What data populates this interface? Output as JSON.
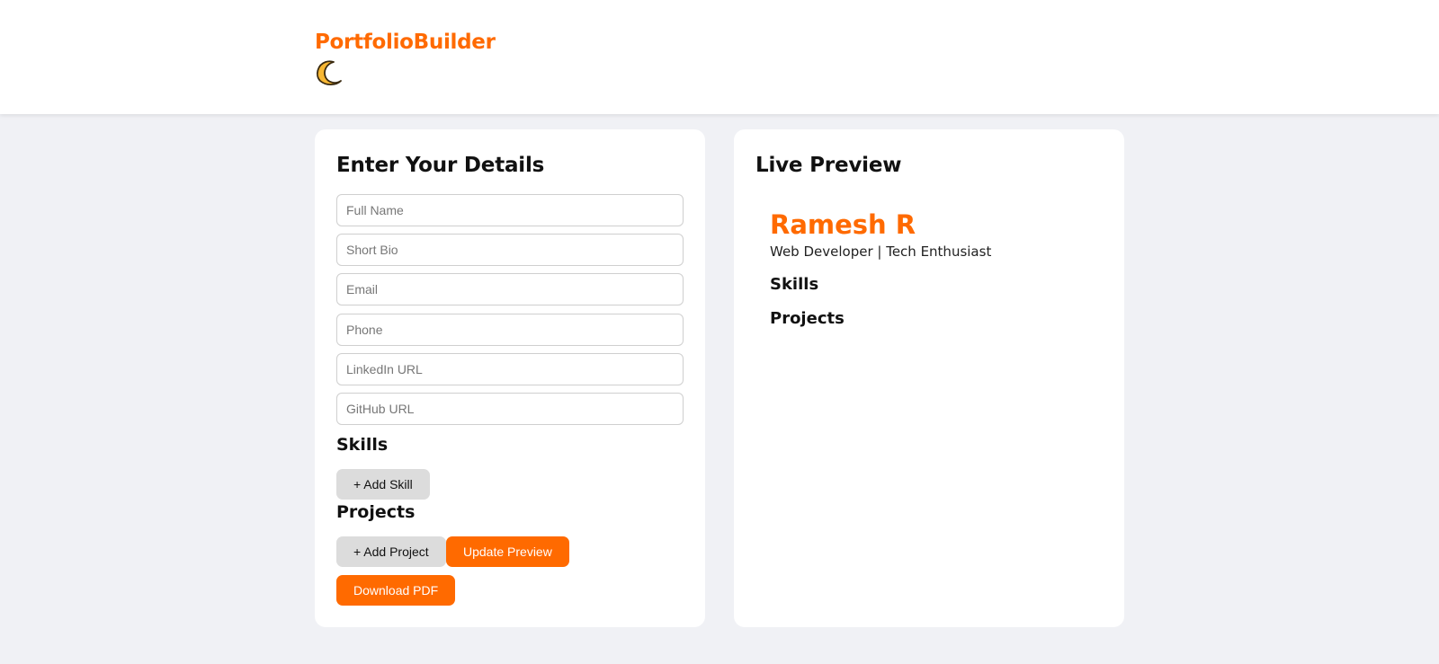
{
  "header": {
    "brand": "PortfolioBuilder",
    "theme_toggle_icon": "crescent-moon-icon"
  },
  "form": {
    "title": "Enter Your Details",
    "fields": {
      "full_name": {
        "placeholder": "Full Name",
        "value": ""
      },
      "short_bio": {
        "placeholder": "Short Bio",
        "value": ""
      },
      "email": {
        "placeholder": "Email",
        "value": ""
      },
      "phone": {
        "placeholder": "Phone",
        "value": ""
      },
      "linkedin": {
        "placeholder": "LinkedIn URL",
        "value": ""
      },
      "github": {
        "placeholder": "GitHub URL",
        "value": ""
      }
    },
    "skills_heading": "Skills",
    "add_skill_label": "+ Add Skill",
    "projects_heading": "Projects",
    "add_project_label": "+ Add Project",
    "update_preview_label": "Update Preview",
    "download_pdf_label": "Download PDF"
  },
  "preview": {
    "title": "Live Preview",
    "name": "Ramesh R",
    "bio": "Web Developer | Tech Enthusiast",
    "skills_heading": "Skills",
    "projects_heading": "Projects"
  },
  "colors": {
    "accent": "#ff6a00",
    "background": "#f0f1f5",
    "card": "#ffffff",
    "secondary_button": "#dcdcdc"
  }
}
